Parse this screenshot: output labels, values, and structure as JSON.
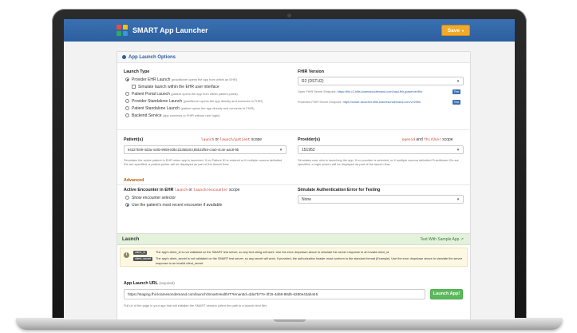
{
  "header": {
    "title": "SMART App Launcher",
    "save_label": "Save"
  },
  "options": {
    "title": "App Launch Options",
    "launch_type": {
      "label": "Launch Type",
      "items": [
        {
          "label": "Provider EHR Launch",
          "hint": "(practitioner opens the app from within an EHR)"
        },
        {
          "label": "Simulate launch within the EHR user interface",
          "hint": ""
        },
        {
          "label": "Patient Portal Launch",
          "hint": "(patient opens the app from within patient portal)"
        },
        {
          "label": "Provider Standalone Launch",
          "hint": "(practitioner opens the app directly and connects to FHIR)"
        },
        {
          "label": "Patient Standalone Launch",
          "hint": "(patient opens the app directly and connects to FHIR)"
        },
        {
          "label": "Backend Service",
          "hint": "(app connects to FHIR without user login)"
        }
      ]
    },
    "fhir_version": {
      "label": "FHIR Version",
      "value": "R2 (DSTU2)",
      "open_label": "Open FHIR Server Endpoint:",
      "open_url": "https://fhir-r2.kfits.kramesondemand.com/hapi-fhir-jpaserver/fhir",
      "protected_label": "Protected FHIR Server Endpoint:",
      "protected_url": "https://smart-launcher.kfits.kramesondemand.com/v/r2/fhir",
      "btn": "Test"
    },
    "patient": {
      "label": "Patient(s)",
      "scope_a": "launch",
      "or": "or",
      "scope_b": "launch/patient",
      "scope": "scope",
      "value": "94327b09-4d3a-4c8b-9959-83bc1b358203,85b32f55-c4a0-4c4e-aac8-9b",
      "help": "Simulates the active patient in EHR when app is launched. If no Patient ID is entered or if multiple comma delimited IDs are specified, a patient picker will be displayed as part of the launch flow."
    },
    "provider": {
      "label": "Provider(s)",
      "scope_a": "openid",
      "and": "and",
      "scope_b": "fhirUser",
      "scope": "scope",
      "value": "151952",
      "help": "Simulates user who is launching the app. If no provider is selected, or if multiple comma delimited Practitioner IDs are specified, a login screen will be displayed as part of the launch flow."
    },
    "advanced": {
      "label": "Advanced",
      "encounter_label": "Active Encounter in EHR",
      "enc_scope_a": "launch",
      "or": "or",
      "enc_scope_b": "launch/encounter",
      "scope": "scope",
      "enc_opt1": "Show encounter selector",
      "enc_opt2": "Use the patient's most recent encounter if available",
      "auth_error_label": "Simulate Authentication Error for Testing",
      "auth_error_value": "None"
    }
  },
  "launch": {
    "title": "Launch",
    "sample_link": "Test With Sample App",
    "tag1": "client_id",
    "tag2": "client_secret",
    "warn1": "The app's client_id is not validated on the SMART test server, so any text string will work. Use the error dropdown above to simulate the server response to an invalid client_id.",
    "warn2": "The app's client_secret is not validated on the SMART test server, so any secret will work. If provided, the authorization header must conform to the standard format (Example). Use the error dropdown above to simulate the server response to an invalid client_secret.",
    "url_label": "App Launch URL",
    "url_required": "(required)",
    "url_value": "https://staging.fhir.kramesondemand.com/launch/SmartHealthIT?tenantId=dda7b77e-3f15-4d69-88db-6280e43ab445",
    "url_help": "Full url of the page in your app that will initialize the SMART session (often the path to a launch.html file)",
    "button": "Launch App!"
  }
}
